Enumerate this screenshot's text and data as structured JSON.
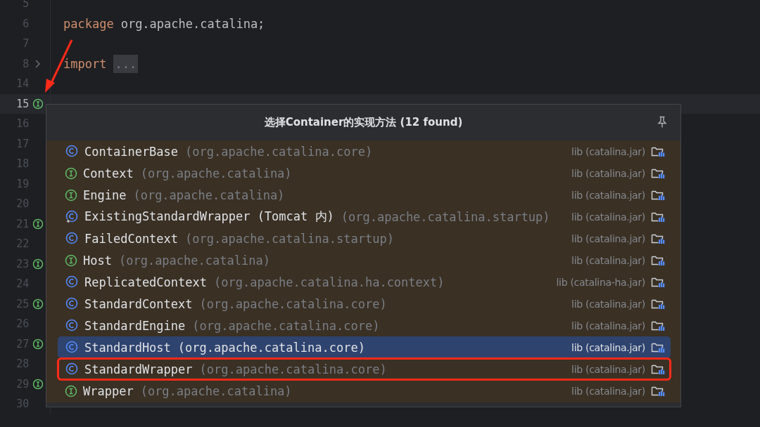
{
  "editor": {
    "lines": [
      {
        "number": "5",
        "gutter_icon": false,
        "current": false
      },
      {
        "number": "6",
        "tokens": [
          {
            "kind": "keyword",
            "text": "package"
          },
          {
            "kind": "plain",
            "text": "org.apache.catalina;"
          }
        ],
        "gutter_icon": false,
        "current": false
      },
      {
        "number": "7",
        "gutter_icon": false,
        "current": false
      },
      {
        "number": "8",
        "tokens": [
          {
            "kind": "keyword",
            "text": "import"
          },
          {
            "kind": "fold",
            "text": "..."
          }
        ],
        "gutter_icon": false,
        "current": false,
        "foldable": true
      },
      {
        "number": "14",
        "gutter_icon": false,
        "current": false
      },
      {
        "number": "15",
        "gutter_icon": true,
        "current": true
      },
      {
        "number": "16",
        "gutter_icon": false,
        "current": false
      },
      {
        "number": "17",
        "gutter_icon": false,
        "current": false
      },
      {
        "number": "18",
        "gutter_icon": false,
        "current": false
      },
      {
        "number": "19",
        "gutter_icon": false,
        "current": false
      },
      {
        "number": "20",
        "gutter_icon": false,
        "current": false
      },
      {
        "number": "21",
        "gutter_icon": true,
        "current": false
      },
      {
        "number": "22",
        "gutter_icon": false,
        "current": false
      },
      {
        "number": "23",
        "gutter_icon": true,
        "current": false
      },
      {
        "number": "24",
        "gutter_icon": false,
        "current": false
      },
      {
        "number": "25",
        "gutter_icon": true,
        "current": false
      },
      {
        "number": "26",
        "gutter_icon": false,
        "current": false
      },
      {
        "number": "27",
        "gutter_icon": true,
        "current": false
      },
      {
        "number": "28",
        "gutter_icon": false,
        "current": false
      },
      {
        "number": "29",
        "gutter_icon": true,
        "current": false
      },
      {
        "number": "30",
        "gutter_icon": false,
        "current": false
      }
    ]
  },
  "popup": {
    "title": "选择Container的实现方法 (12 found)",
    "items": [
      {
        "kind": "class",
        "name": "ContainerBase",
        "package": "(org.apache.catalina.core)",
        "location": "lib (catalina.jar)",
        "selected": false,
        "highlighted": false
      },
      {
        "kind": "interface",
        "name": "Context",
        "package": "(org.apache.catalina)",
        "location": "lib (catalina.jar)",
        "selected": false,
        "highlighted": false
      },
      {
        "kind": "interface",
        "name": "Engine",
        "package": "(org.apache.catalina)",
        "location": "lib (catalina.jar)",
        "selected": false,
        "highlighted": false
      },
      {
        "kind": "local-class",
        "name": "ExistingStandardWrapper (Tomcat 内)",
        "package": "(org.apache.catalina.startup)",
        "location": "lib (catalina.jar)",
        "selected": false,
        "highlighted": false
      },
      {
        "kind": "class",
        "name": "FailedContext",
        "package": "(org.apache.catalina.startup)",
        "location": "lib (catalina.jar)",
        "selected": false,
        "highlighted": false
      },
      {
        "kind": "interface",
        "name": "Host",
        "package": "(org.apache.catalina)",
        "location": "lib (catalina.jar)",
        "selected": false,
        "highlighted": false
      },
      {
        "kind": "class",
        "name": "ReplicatedContext",
        "package": "(org.apache.catalina.ha.context)",
        "location": "lib (catalina-ha.jar)",
        "selected": false,
        "highlighted": false
      },
      {
        "kind": "class",
        "name": "StandardContext",
        "package": "(org.apache.catalina.core)",
        "location": "lib (catalina.jar)",
        "selected": false,
        "highlighted": false
      },
      {
        "kind": "class",
        "name": "StandardEngine",
        "package": "(org.apache.catalina.core)",
        "location": "lib (catalina.jar)",
        "selected": false,
        "highlighted": false
      },
      {
        "kind": "class",
        "name": "StandardHost",
        "package": "(org.apache.catalina.core)",
        "location": "lib (catalina.jar)",
        "selected": true,
        "highlighted": false
      },
      {
        "kind": "class",
        "name": "StandardWrapper",
        "package": "(org.apache.catalina.core)",
        "location": "lib (catalina.jar)",
        "selected": false,
        "highlighted": true
      },
      {
        "kind": "interface",
        "name": "Wrapper",
        "package": "(org.apache.catalina)",
        "location": "lib (catalina.jar)",
        "selected": false,
        "highlighted": false
      }
    ]
  }
}
